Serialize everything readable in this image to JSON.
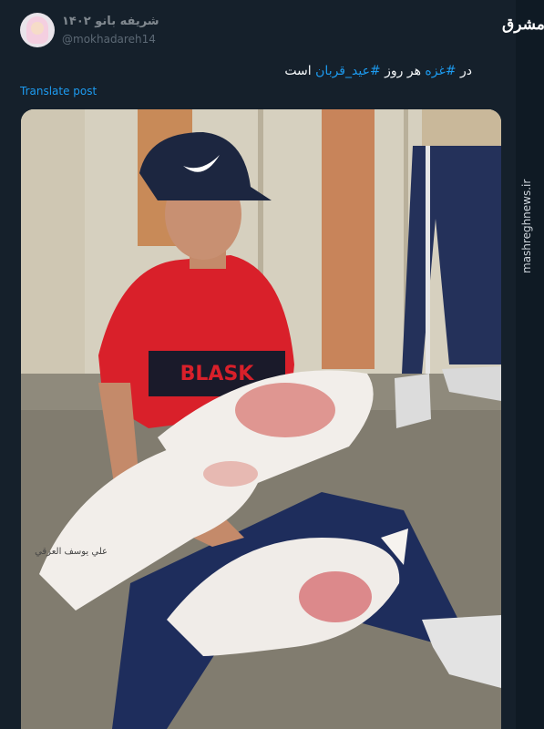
{
  "post": {
    "display_name": "شریفه بانو ۱۴۰۲",
    "handle": "@mokhadareh14",
    "text_before": "در ",
    "hashtag_1": "#غزه",
    "text_middle": " هر روز ",
    "hashtag_2": "#عید_قربان",
    "text_after": " است",
    "translate_label": "Translate post"
  },
  "watermark": {
    "logo_text": "مشرق",
    "site": "mashreghnews.ir"
  },
  "photo": {
    "shroud_label": "علي يوسف العرقي",
    "shirt_text": "BLASK"
  },
  "colors": {
    "background": "#15202b",
    "text": "#f5f8fa",
    "link": "#1d9bf0",
    "muted": "#8b98a5"
  }
}
